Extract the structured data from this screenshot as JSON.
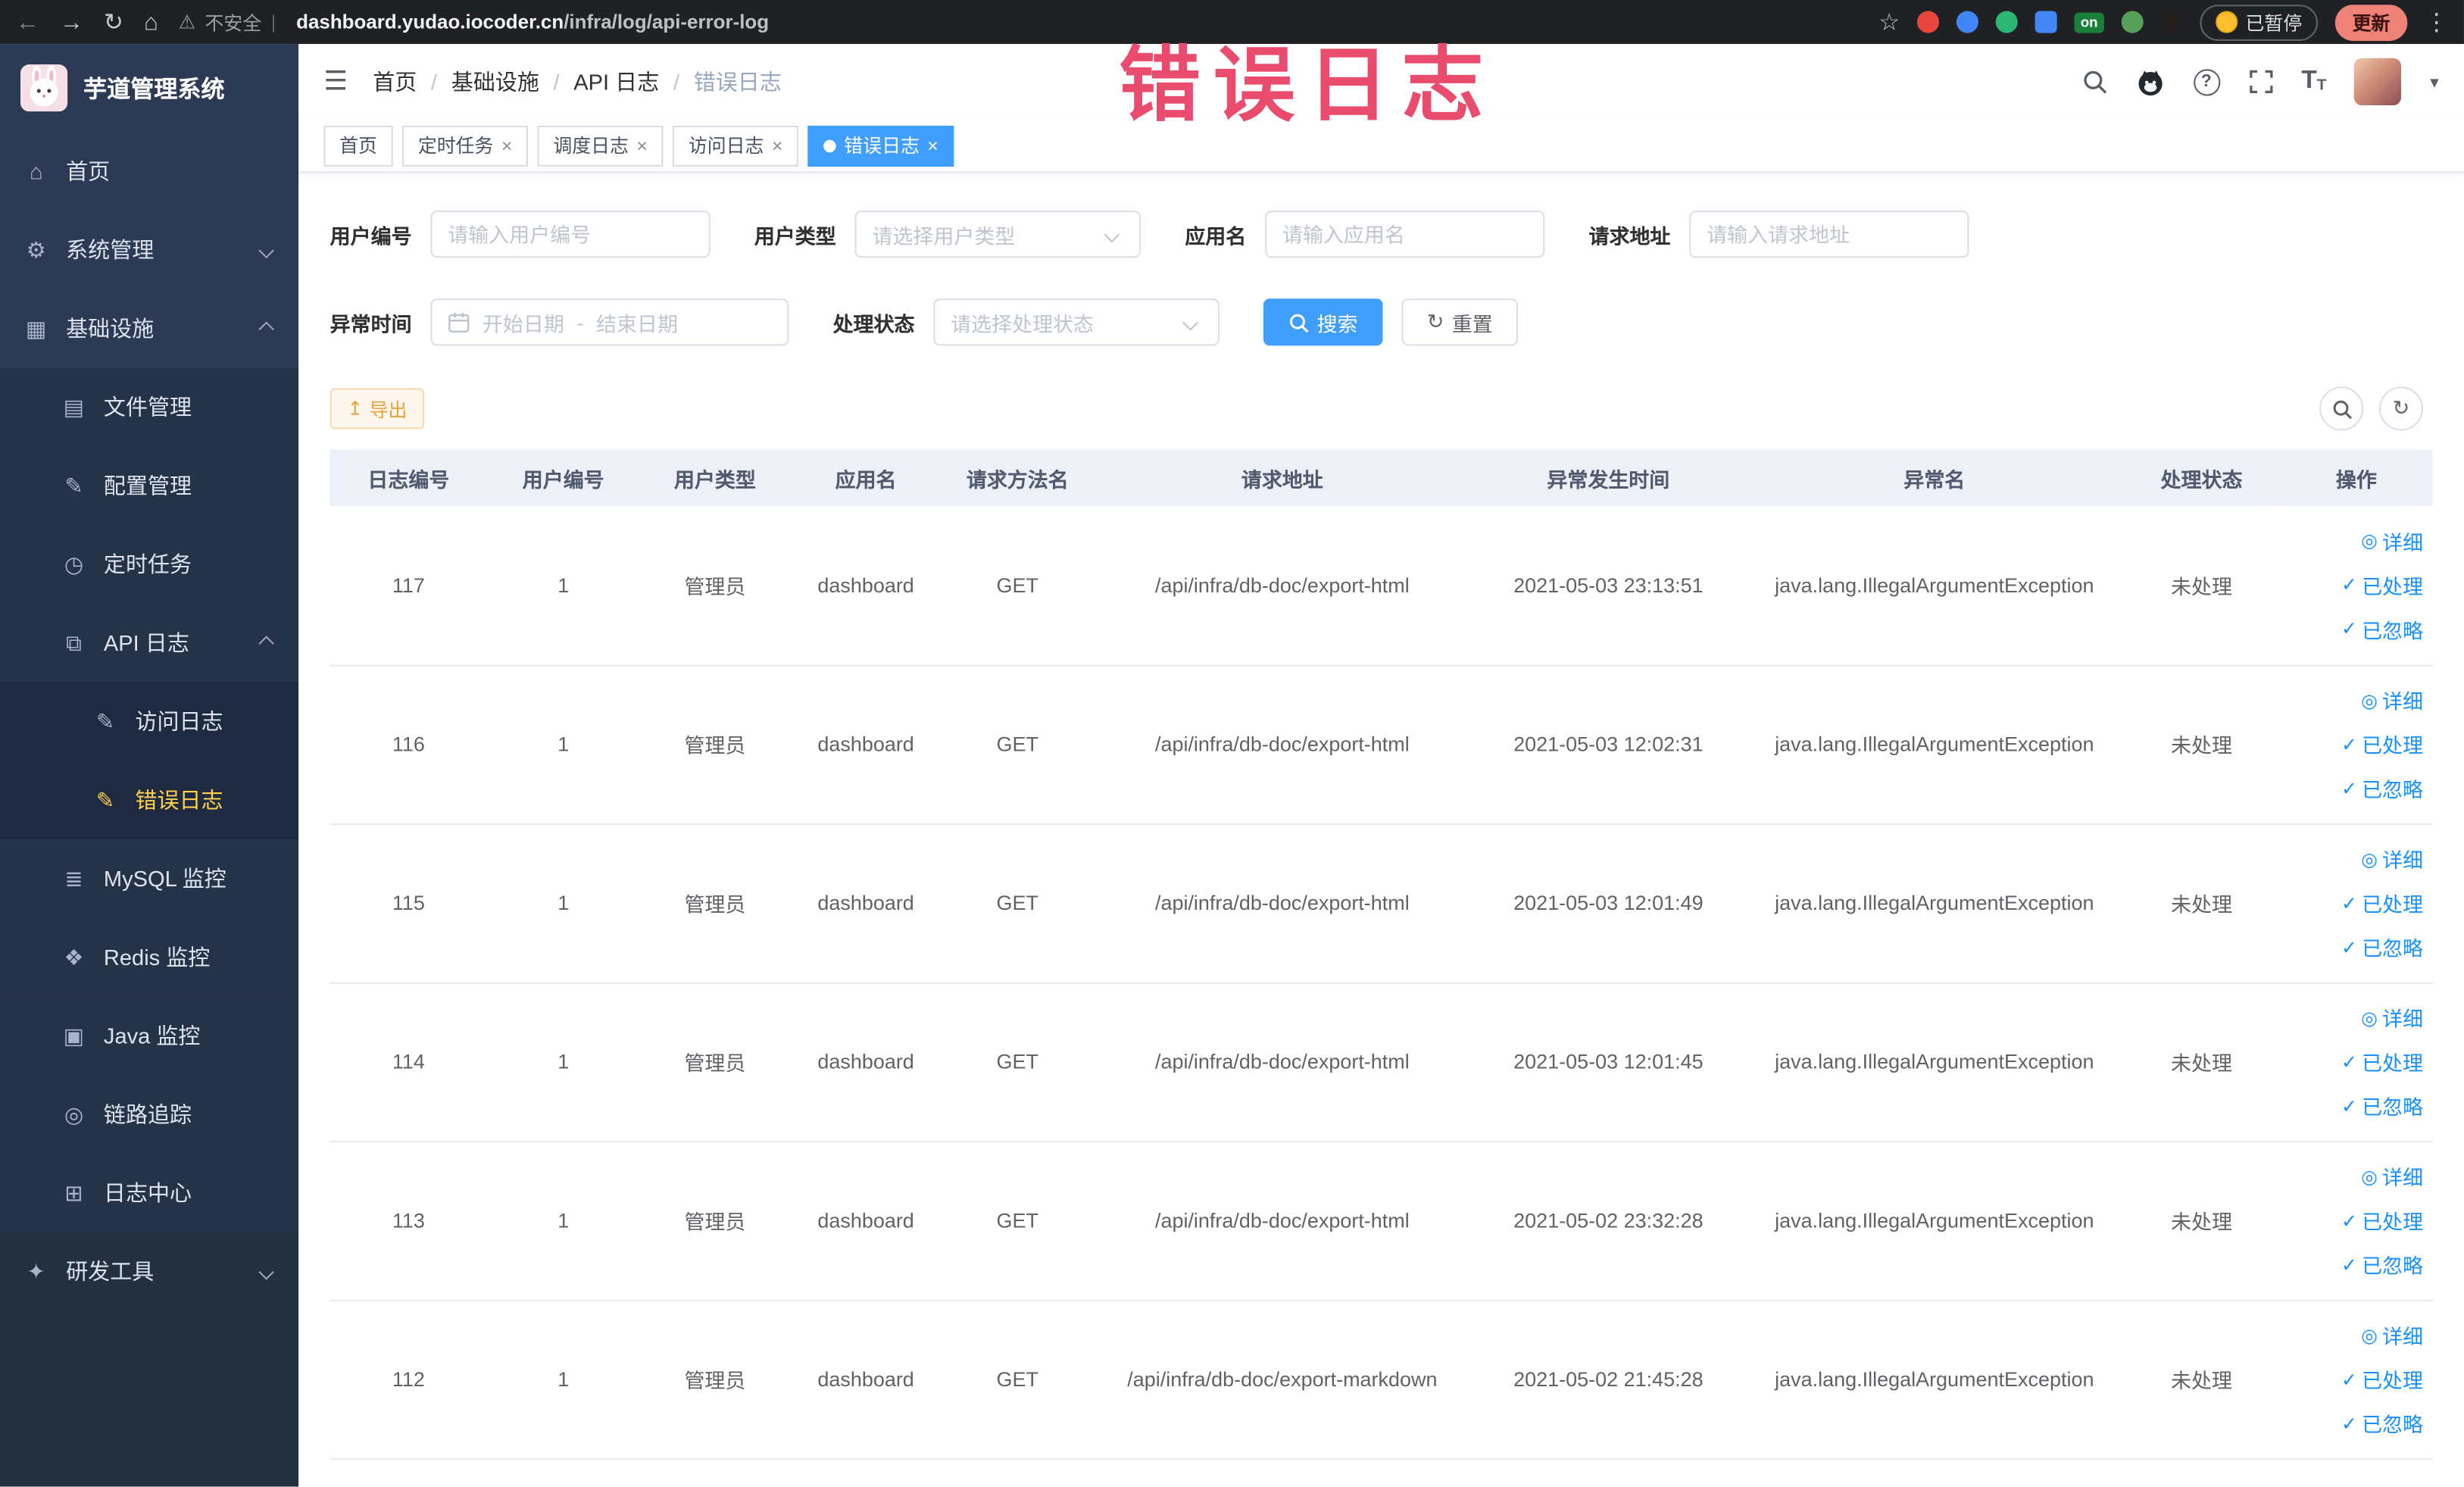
{
  "theme": {
    "accent_blue": "#409eff",
    "link_blue": "#1890ff",
    "sidebar_bg": "#2c3a55",
    "active_menu_gold": "#ffd04b",
    "warning_orange": "#e6a23c",
    "annotation_red": "#ea4c6d"
  },
  "icons": {
    "back": "←",
    "forward": "→",
    "reload": "↻",
    "home": "⌂",
    "warning": "⚠",
    "star": "☆",
    "dots": "⋮",
    "hamburger": "☰",
    "caret_down": "▾",
    "close": "×",
    "check": "✓",
    "eye": "◎",
    "export": "↥",
    "sidebar": {
      "home": "⌂",
      "system": "⚙",
      "infra": "▦",
      "file": "▤",
      "config": "✎",
      "task": "◷",
      "apilog": "⧉",
      "access": "✎",
      "error": "✎",
      "mysql": "≣",
      "redis": "❖",
      "java": "▣",
      "trace": "◎",
      "logcenter": "⊞",
      "devtools": "✦"
    }
  },
  "browser": {
    "security_text": "不安全",
    "url_domain": "dashboard.yudao.iocoder.cn",
    "url_path": "/infra/log/api-error-log",
    "ext_badge_on": "on",
    "paused_badge": "已暂停",
    "update_button": "更新"
  },
  "annotation": {
    "text": "错误日志"
  },
  "sidebar": {
    "logo_title": "芋道管理系统",
    "items": [
      {
        "label": "首页"
      },
      {
        "label": "系统管理"
      },
      {
        "label": "基础设施"
      },
      {
        "label": "文件管理"
      },
      {
        "label": "配置管理"
      },
      {
        "label": "定时任务"
      },
      {
        "label": "API 日志"
      },
      {
        "label": "访问日志"
      },
      {
        "label": "错误日志"
      },
      {
        "label": "MySQL 监控"
      },
      {
        "label": "Redis 监控"
      },
      {
        "label": "Java 监控"
      },
      {
        "label": "链路追踪"
      },
      {
        "label": "日志中心"
      },
      {
        "label": "研发工具"
      }
    ]
  },
  "header": {
    "breadcrumb": [
      "首页",
      "基础设施",
      "API 日志",
      "错误日志"
    ],
    "breadcrumb_separator": "/"
  },
  "tabs": [
    {
      "label": "首页"
    },
    {
      "label": "定时任务"
    },
    {
      "label": "调度日志"
    },
    {
      "label": "访问日志"
    },
    {
      "label": "错误日志"
    }
  ],
  "filters": {
    "user_id": {
      "label": "用户编号",
      "placeholder": "请输入用户编号",
      "value": ""
    },
    "user_type": {
      "label": "用户类型",
      "placeholder": "请选择用户类型"
    },
    "app_name": {
      "label": "应用名",
      "placeholder": "请输入应用名",
      "value": ""
    },
    "request_url": {
      "label": "请求地址",
      "placeholder": "请输入请求地址",
      "value": ""
    },
    "exception_time": {
      "label": "异常时间",
      "start_placeholder": "开始日期",
      "separator": "-",
      "end_placeholder": "结束日期"
    },
    "process_status": {
      "label": "处理状态",
      "placeholder": "请选择处理状态"
    },
    "search_button": "搜索",
    "reset_button": "重置"
  },
  "toolbar": {
    "export_button": "导出"
  },
  "table": {
    "columns": [
      "日志编号",
      "用户编号",
      "用户类型",
      "应用名",
      "请求方法名",
      "请求地址",
      "异常发生时间",
      "异常名",
      "处理状态",
      "操作"
    ],
    "actions": {
      "detail": "详细",
      "processed": "已处理",
      "ignored": "已忽略"
    },
    "rows": [
      {
        "id": "117",
        "user_id": "1",
        "user_type": "管理员",
        "app": "dashboard",
        "method": "GET",
        "url": "/api/infra/db-doc/export-html",
        "time": "2021-05-03 23:13:51",
        "exception": "java.lang.IllegalArgumentException",
        "status": "未处理"
      },
      {
        "id": "116",
        "user_id": "1",
        "user_type": "管理员",
        "app": "dashboard",
        "method": "GET",
        "url": "/api/infra/db-doc/export-html",
        "time": "2021-05-03 12:02:31",
        "exception": "java.lang.IllegalArgumentException",
        "status": "未处理"
      },
      {
        "id": "115",
        "user_id": "1",
        "user_type": "管理员",
        "app": "dashboard",
        "method": "GET",
        "url": "/api/infra/db-doc/export-html",
        "time": "2021-05-03 12:01:49",
        "exception": "java.lang.IllegalArgumentException",
        "status": "未处理"
      },
      {
        "id": "114",
        "user_id": "1",
        "user_type": "管理员",
        "app": "dashboard",
        "method": "GET",
        "url": "/api/infra/db-doc/export-html",
        "time": "2021-05-03 12:01:45",
        "exception": "java.lang.IllegalArgumentException",
        "status": "未处理"
      },
      {
        "id": "113",
        "user_id": "1",
        "user_type": "管理员",
        "app": "dashboard",
        "method": "GET",
        "url": "/api/infra/db-doc/export-html",
        "time": "2021-05-02 23:32:28",
        "exception": "java.lang.IllegalArgumentException",
        "status": "未处理"
      },
      {
        "id": "112",
        "user_id": "1",
        "user_type": "管理员",
        "app": "dashboard",
        "method": "GET",
        "url": "/api/infra/db-doc/export-markdown",
        "time": "2021-05-02 21:45:28",
        "exception": "java.lang.IllegalArgumentException",
        "status": "未处理"
      }
    ]
  }
}
